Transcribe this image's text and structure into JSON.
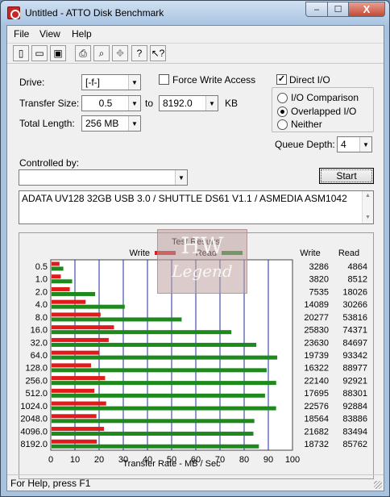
{
  "window": {
    "title": "Untitled - ATTO Disk Benchmark",
    "min": "–",
    "max": "☐",
    "close": "X"
  },
  "menu": [
    "File",
    "View",
    "Help"
  ],
  "toolbar": [
    {
      "name": "new-icon",
      "glyph": "▯"
    },
    {
      "name": "open-icon",
      "glyph": "▭"
    },
    {
      "name": "save-icon",
      "glyph": "▣"
    },
    {
      "name": "print-icon",
      "glyph": "⎙"
    },
    {
      "name": "print-preview-icon",
      "glyph": "⌕"
    },
    {
      "name": "move-icon",
      "glyph": "✥"
    },
    {
      "name": "help-icon",
      "glyph": "?"
    },
    {
      "name": "context-help-icon",
      "glyph": "↖?"
    }
  ],
  "settings": {
    "drive_label": "Drive:",
    "drive_value": "[-f-]",
    "force_write_label": "Force Write Access",
    "force_write_checked": false,
    "transfer_size_label": "Transfer Size:",
    "transfer_from": "0.5",
    "to_label": "to",
    "transfer_to": "8192.0",
    "kb_label": "KB",
    "total_length_label": "Total Length:",
    "total_length_value": "256 MB",
    "direct_io_label": "Direct I/O",
    "direct_io_checked": true,
    "io_comparison_label": "I/O Comparison",
    "overlapped_io_label": "Overlapped I/O",
    "neither_label": "Neither",
    "selected_io_mode": "Overlapped I/O",
    "queue_depth_label": "Queue Depth:",
    "queue_depth_value": "4",
    "controlled_by_label": "Controlled by:",
    "controlled_by_value": "",
    "start_label": "Start"
  },
  "description": "ADATA UV128 32GB USB 3.0 / SHUTTLE DS61 V1.1 / ASMEDIA ASM1042",
  "watermark": {
    "line1": "HW",
    "line2": "Legend"
  },
  "results": {
    "title": "Test Results",
    "write_legend": "Write",
    "read_legend": "Read",
    "col_write": "Write",
    "col_read": "Read",
    "write_color": "#e01b1b",
    "read_color": "#1e8a1e"
  },
  "chart_data": {
    "type": "bar",
    "title": "Test Results",
    "xlabel": "Transfer Rate - MB / Sec",
    "ylabel": "",
    "xlim": [
      0,
      100
    ],
    "xticks": [
      0,
      10,
      20,
      30,
      40,
      50,
      60,
      70,
      80,
      90,
      100
    ],
    "categories": [
      "0.5",
      "1.0",
      "2.0",
      "4.0",
      "8.0",
      "16.0",
      "32.0",
      "64.0",
      "128.0",
      "256.0",
      "512.0",
      "1024.0",
      "2048.0",
      "4096.0",
      "8192.0"
    ],
    "series": [
      {
        "name": "Write",
        "values": [
          3286,
          3820,
          7535,
          14089,
          20277,
          25830,
          23630,
          19739,
          16322,
          22140,
          17695,
          22576,
          18564,
          21682,
          18732
        ]
      },
      {
        "name": "Read",
        "values": [
          4864,
          8512,
          18026,
          30266,
          53816,
          74371,
          84697,
          93342,
          88977,
          92921,
          88301,
          92884,
          83886,
          83494,
          85762
        ]
      }
    ],
    "legend": "top-center",
    "grid": true
  },
  "status": {
    "text": "For Help, press F1"
  }
}
